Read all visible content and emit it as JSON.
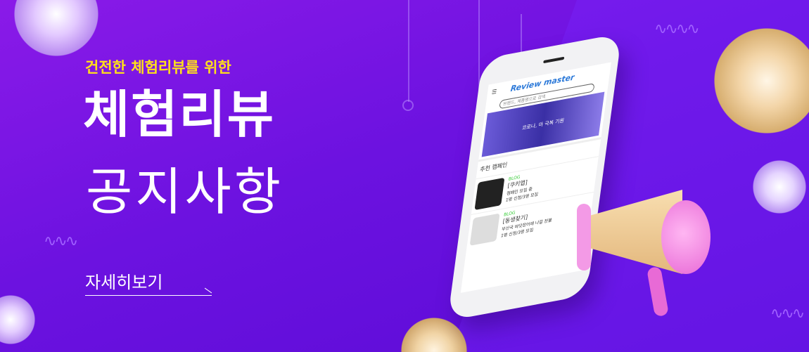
{
  "banner": {
    "subtitle": "건전한 체험리뷰를 위한",
    "title_bold": "체험리뷰",
    "title_light": "공지사항",
    "more_link": "자세히보기",
    "colors": {
      "background": "#6c12e0",
      "subtitle": "#ffe01a",
      "text": "#ffffff"
    }
  },
  "phone": {
    "logo": "Review master",
    "menu_icon": "hamburger-icon",
    "search_placeholder": "브랜드, 제품명으로 검색",
    "search_icon": "search-icon",
    "hero_text": "코로나, 마 극복 기원",
    "section_title": "추천 캠페인",
    "cards": [
      {
        "tag": "BLOG",
        "title": "[쿠키앱]",
        "desc": "캠페인 모집 중",
        "meta": "1명 신청/3명 모집"
      },
      {
        "tag": "BLOG",
        "title": "[동생찾기]",
        "desc": "부산국 바닷장어에 나갈 찬불",
        "meta": "1명 신청/3명 모집"
      }
    ]
  }
}
